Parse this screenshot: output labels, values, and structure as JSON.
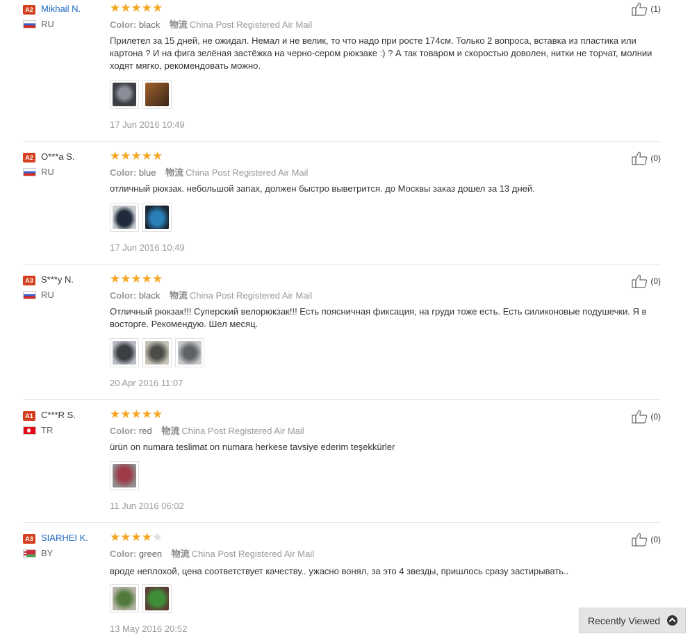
{
  "reviews": [
    {
      "level": "A2",
      "name": "Mikhail N.",
      "country": "RU",
      "stars": 5,
      "color_label": "Color:",
      "color_value": "black",
      "ship_icon": "物流",
      "shipping": "China Post Registered Air Mail",
      "text": "Прилетел за 15 дней, не ожидал. Немал и не велик, то что надо при росте 174см. Только 2 вопроса, вставка из пластика или картона ? И на фига зелёная застёжка на черно-сером рюкзаке :) ? А так товаром и скоростью доволен, нитки не торчат, молнии ходят мягко, рекомендовать можно.",
      "photos": [
        "#3d3f45",
        "#6b3a22"
      ],
      "date": "17 Jun 2016 10:49",
      "helpful": "(1)"
    },
    {
      "level": "A2",
      "name": "O***a S.",
      "country": "RU",
      "stars": 5,
      "color_label": "Color:",
      "color_value": "blue",
      "ship_icon": "物流",
      "shipping": "China Post Registered Air Mail",
      "text": "отличный рюкзак. небольшой запах, должен быстро выветрится. до Москвы заказ дошел за 13 дней.",
      "photos": [
        "#2b3340",
        "#2a7fb8"
      ],
      "date": "17 Jun 2016 10:49",
      "helpful": "(0)"
    },
    {
      "level": "A3",
      "name": "S***y N.",
      "country": "RU",
      "stars": 5,
      "color_label": "Color:",
      "color_value": "black",
      "ship_icon": "物流",
      "shipping": "China Post Registered Air Mail",
      "text": "Отличный рюкзак!!! Суперский велорюкзак!!! Есть поясничная фиксация, на груди тоже есть. Есть силиконовые подушечки. Я в восторге. Рекомендую. Шел месяц.",
      "photos": [
        "#55585c",
        "#8c8a80",
        "#6e7175"
      ],
      "date": "20 Apr 2016 11:07",
      "helpful": "(0)"
    },
    {
      "level": "A1",
      "name": "C***R S.",
      "country": "TR",
      "stars": 5,
      "color_label": "Color:",
      "color_value": "red",
      "ship_icon": "物流",
      "shipping": "China Post Registered Air Mail",
      "text": "ürün on numara teslimat on numara herkese tavsiye ederim teşekkürler",
      "photos": [
        "#9c3a48"
      ],
      "date": "11 Jun 2016 06:02",
      "helpful": "(0)"
    },
    {
      "level": "A3",
      "name": "SIARHEI K.",
      "country": "BY",
      "stars": 4,
      "color_label": "Color:",
      "color_value": "green",
      "ship_icon": "物流",
      "shipping": "China Post Registered Air Mail",
      "text": "вроде неплохой, цена соответствует качеству.. ужасно вонял, за это 4 звезды, пришлось сразу застирывать..",
      "photos": [
        "#4f7a3a",
        "#3f8f3a"
      ],
      "date": "13 May 2016 20:52",
      "helpful": "(0)"
    }
  ],
  "recently_viewed": {
    "label": "Recently Viewed",
    "icon": "chevron-up-circle-icon"
  },
  "colors": {
    "badge": "#d4401f",
    "star": "#f5a623",
    "link": "#1a66c2"
  }
}
